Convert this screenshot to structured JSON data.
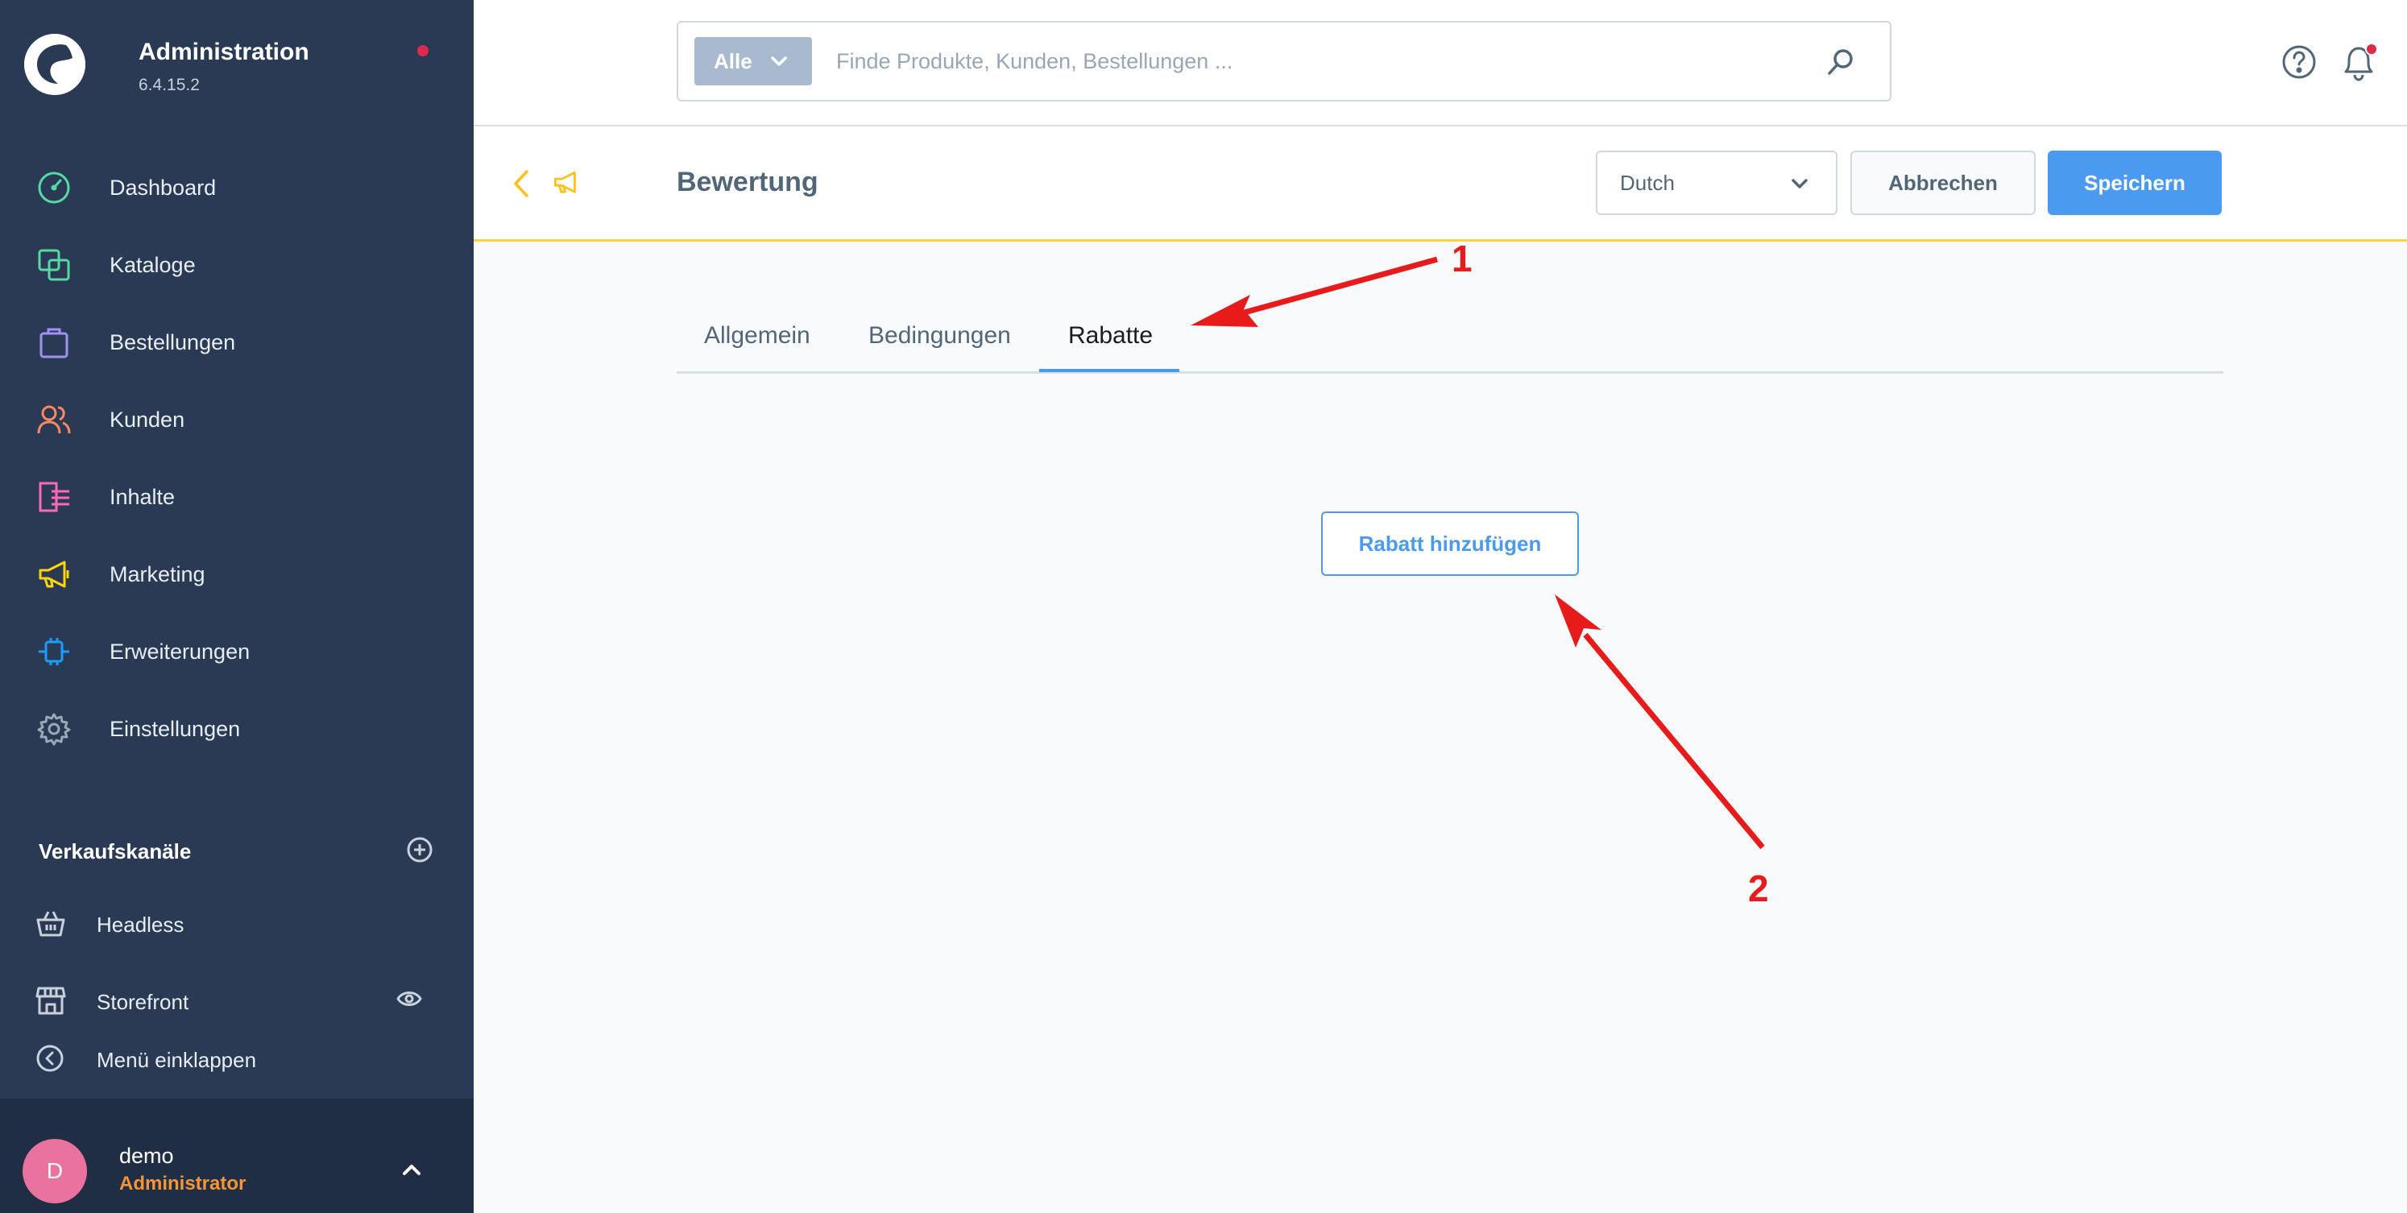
{
  "sidebar": {
    "brand_title": "Administration",
    "brand_version": "6.4.15.2",
    "nav": [
      {
        "label": "Dashboard",
        "icon": "dashboard-icon",
        "color": "#57d9a3"
      },
      {
        "label": "Kataloge",
        "icon": "catalog-icon",
        "color": "#57d9a3"
      },
      {
        "label": "Bestellungen",
        "icon": "orders-icon",
        "color": "#a092f0"
      },
      {
        "label": "Kunden",
        "icon": "customers-icon",
        "color": "#f88962"
      },
      {
        "label": "Inhalte",
        "icon": "content-icon",
        "color": "#ff68b4"
      },
      {
        "label": "Marketing",
        "icon": "marketing-icon",
        "color": "#ffd700"
      },
      {
        "label": "Erweiterungen",
        "icon": "extensions-icon",
        "color": "#189eff"
      },
      {
        "label": "Einstellungen",
        "icon": "settings-icon",
        "color": "#9aa8b5"
      }
    ],
    "sales_channels_title": "Verkaufskanäle",
    "sales_channels": [
      {
        "label": "Headless"
      },
      {
        "label": "Storefront"
      }
    ],
    "collapse_label": "Menü einklappen",
    "user": {
      "initial": "D",
      "name": "demo",
      "role": "Administrator"
    }
  },
  "topbar": {
    "search_type": "Alle",
    "search_placeholder": "Finde Produkte, Kunden, Bestellungen ..."
  },
  "page": {
    "title": "Bewertung",
    "language": "Dutch",
    "cancel_label": "Abbrechen",
    "save_label": "Speichern"
  },
  "tabs": [
    {
      "label": "Allgemein"
    },
    {
      "label": "Bedingungen"
    },
    {
      "label": "Rabatte",
      "active": true
    }
  ],
  "main": {
    "add_discount_label": "Rabatt hinzufügen"
  },
  "annotations": {
    "step1": "1",
    "step2": "2",
    "color": "#e81b1b"
  }
}
